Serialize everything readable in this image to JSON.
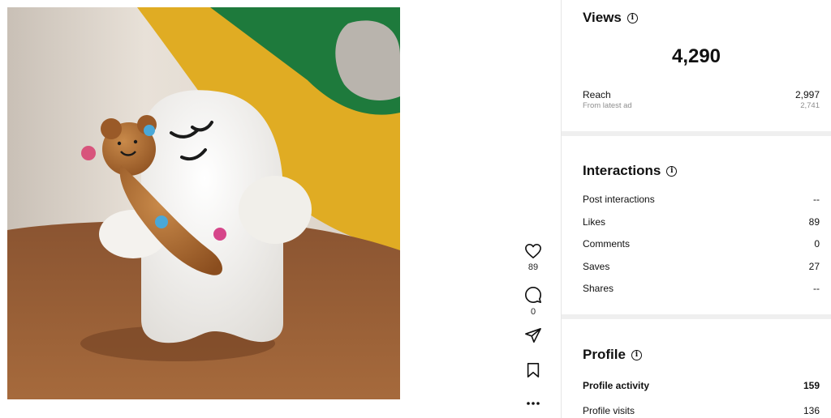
{
  "post": {
    "image_alt": "Clay ghost figurine hugging a small amber bear",
    "actions": {
      "likes_count": "89",
      "comments_count": "0"
    }
  },
  "insights": {
    "views": {
      "title": "Views",
      "total": "4,290",
      "reach_label": "Reach",
      "reach_value": "2,997",
      "sub_label": "From latest ad",
      "sub_value": "2,741"
    },
    "interactions": {
      "title": "Interactions",
      "rows": [
        {
          "label": "Post interactions",
          "value": "--"
        },
        {
          "label": "Likes",
          "value": "89"
        },
        {
          "label": "Comments",
          "value": "0"
        },
        {
          "label": "Saves",
          "value": "27"
        },
        {
          "label": "Shares",
          "value": "--"
        }
      ]
    },
    "profile": {
      "title": "Profile",
      "rows": [
        {
          "label": "Profile activity",
          "value": "159"
        },
        {
          "label": "Profile visits",
          "value": "136"
        }
      ]
    }
  }
}
